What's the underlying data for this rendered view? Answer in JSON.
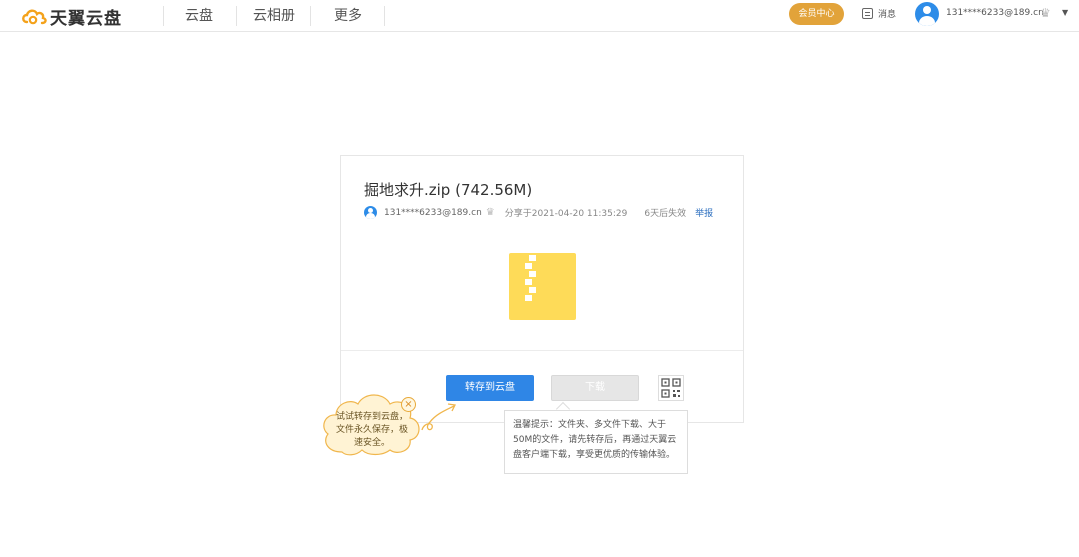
{
  "header": {
    "logo_text": "天翼云盘",
    "nav": [
      "云盘",
      "云相册",
      "更多"
    ],
    "vip_label": "会员中心",
    "message_label": "消息",
    "username": "131****6233@189.cn"
  },
  "file": {
    "title": "掘地求升.zip (742.56M)",
    "owner": "131****6233@189.cn",
    "shared_at": "分享于2021-04-20 11:35:29",
    "expires": "6天后失效",
    "report_label": "举报"
  },
  "actions": {
    "save_label": "转存到云盘",
    "download_label": "下载"
  },
  "tooltip": {
    "text": "温馨提示：文件夹、多文件下载、大于50M的文件，请先转存后，再通过天翼云盘客户端下载，享受更优质的传输体验。"
  },
  "bubble": {
    "text": "试试转存到云盘，文件永久保存，极速安全。"
  },
  "colors": {
    "brand_orange": "#f4a21b",
    "primary_blue": "#2f86e6",
    "vip_gold": "#e2a33a",
    "zip_yellow": "#fedb58"
  },
  "icons": {
    "logo": "cloud-logo-icon",
    "message": "message-icon",
    "avatar": "user-avatar-icon",
    "crown": "crown-icon",
    "caret": "caret-down-icon",
    "zip": "zip-file-icon",
    "qr": "qr-code-icon",
    "close": "close-icon"
  }
}
